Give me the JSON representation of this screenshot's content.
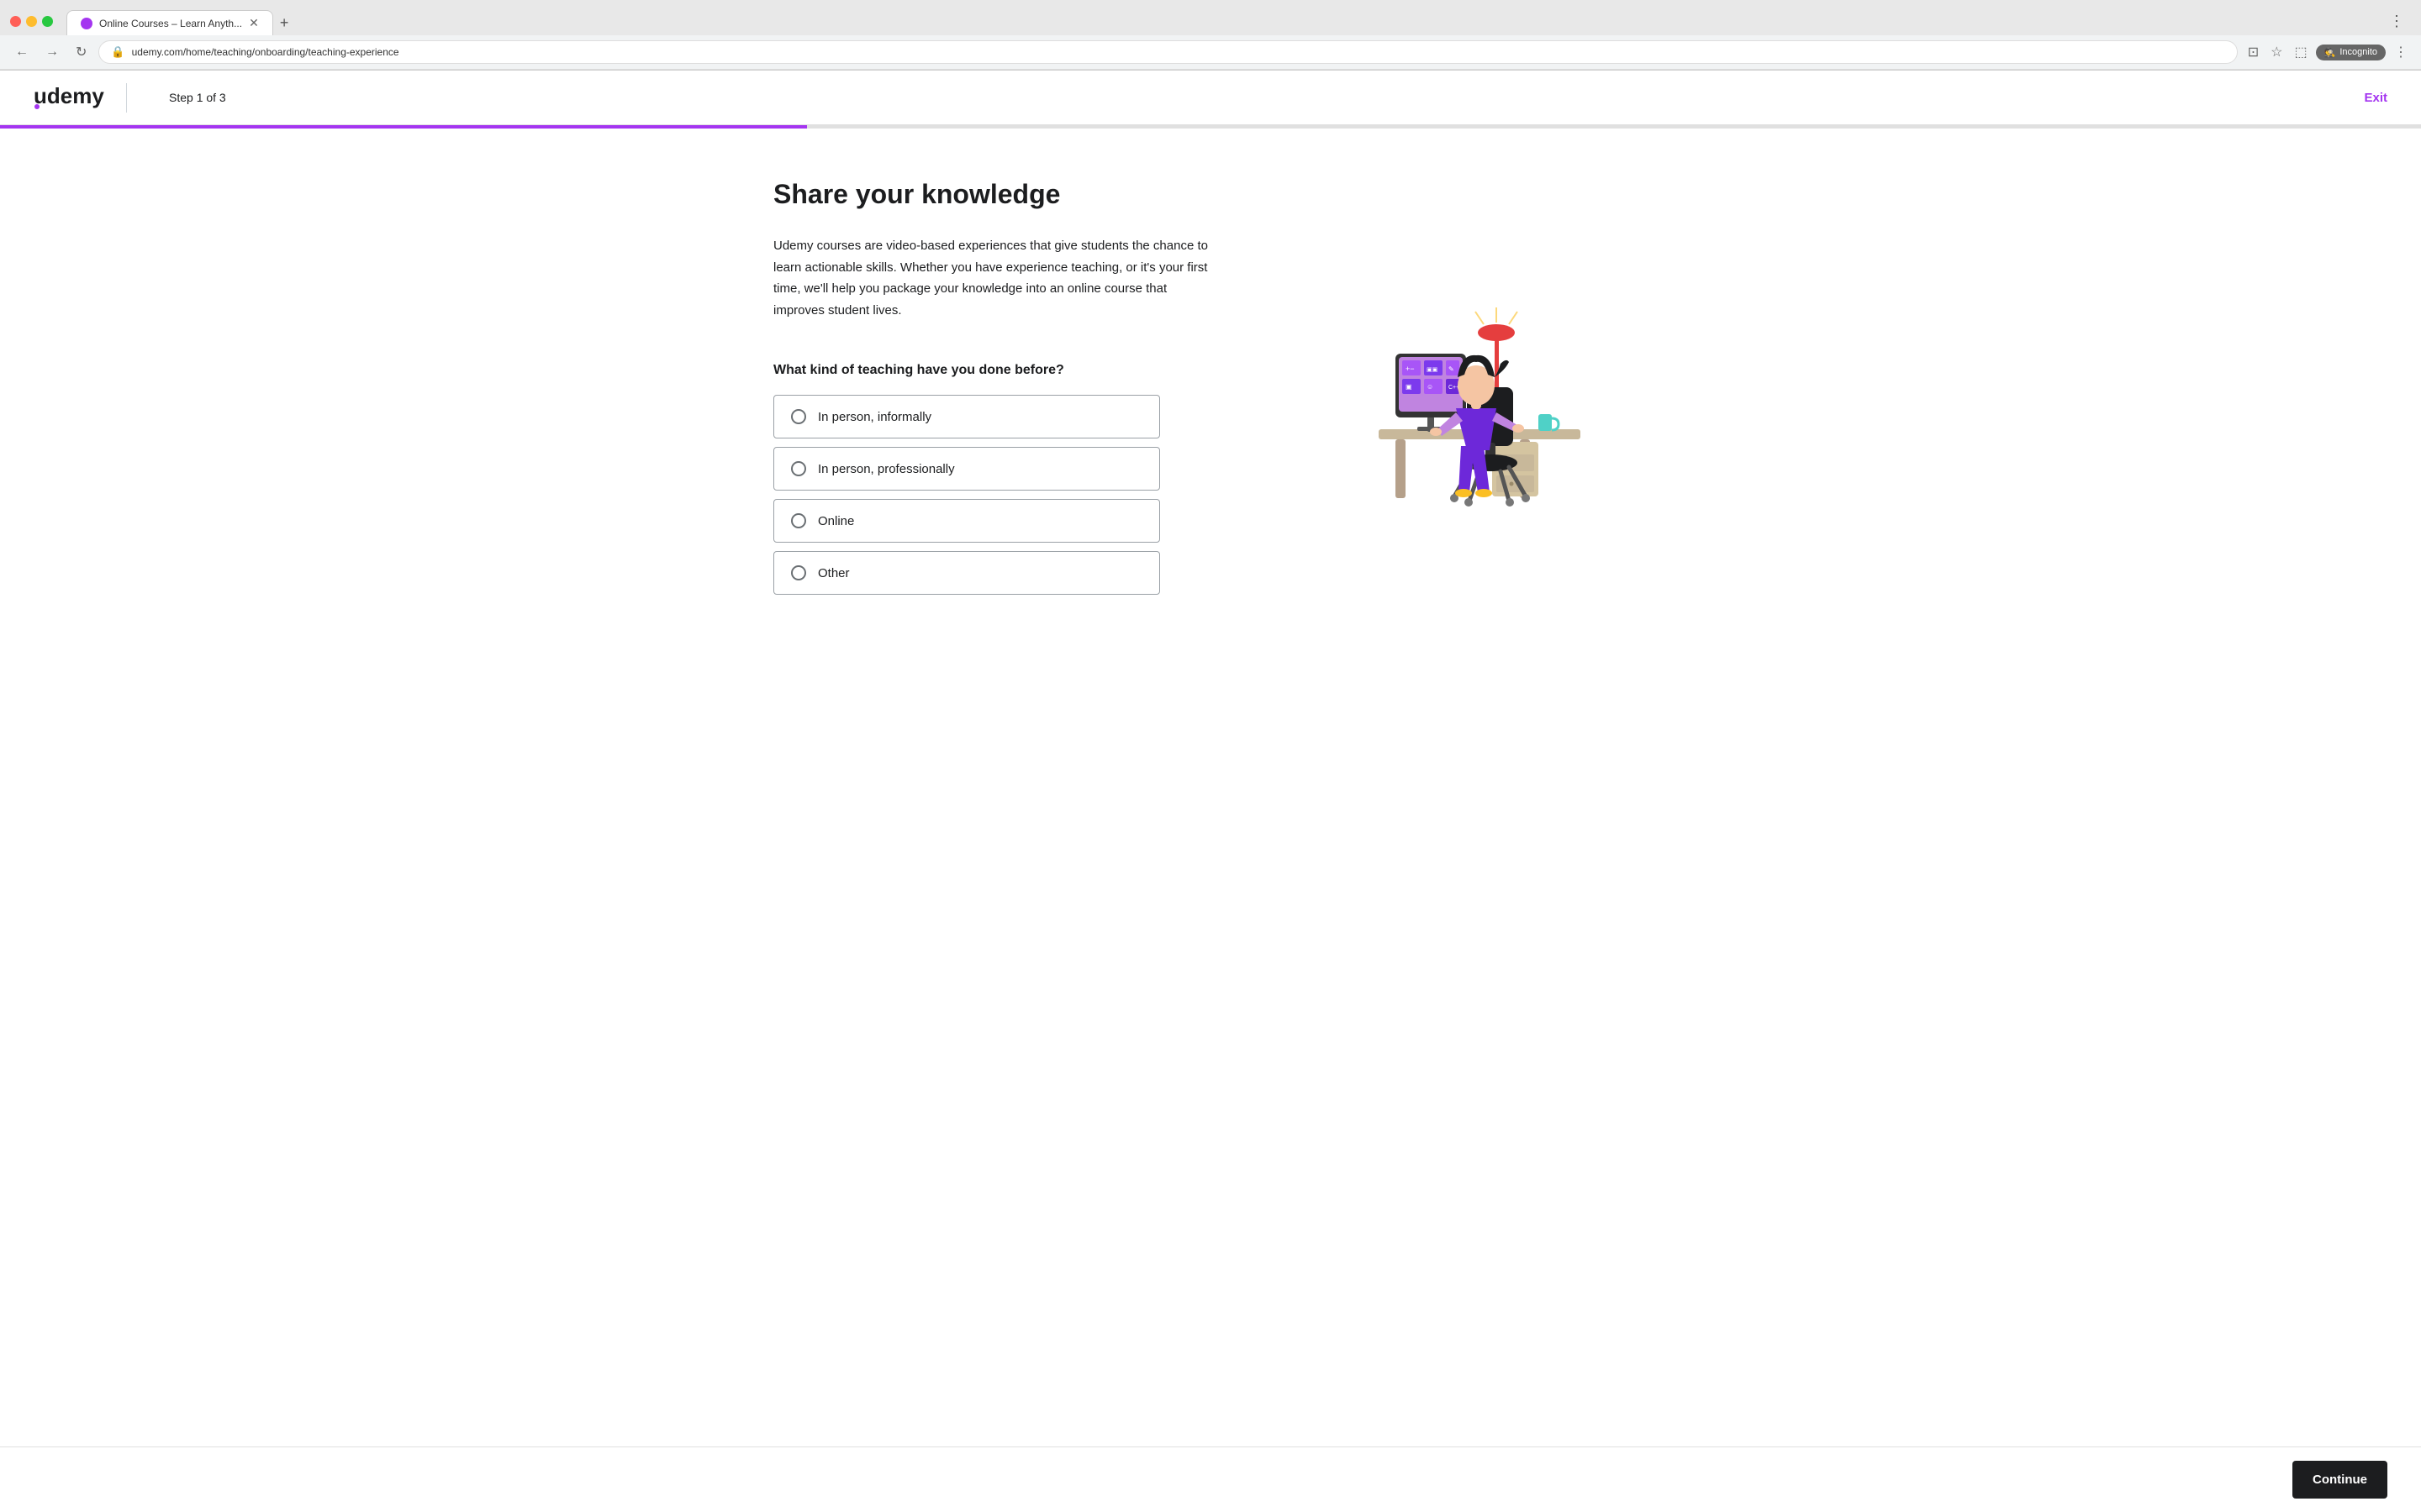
{
  "browser": {
    "tab_title": "Online Courses – Learn Anyth...",
    "url": "udemy.com/home/teaching/onboarding/teaching-experience",
    "incognito_label": "Incognito",
    "new_tab_label": "+"
  },
  "header": {
    "logo_text": "udemy",
    "step_label": "Step 1 of 3",
    "exit_label": "Exit"
  },
  "progress": {
    "percent": 33.33
  },
  "page": {
    "title": "Share your knowledge",
    "description": "Udemy courses are video-based experiences that give students the chance to learn actionable skills. Whether you have experience teaching, or it's your first time, we'll help you package your knowledge into an online course that improves student lives.",
    "question": "What kind of teaching have you done before?",
    "options": [
      {
        "id": "in-person-informally",
        "label": "In person, informally"
      },
      {
        "id": "in-person-professionally",
        "label": "In person, professionally"
      },
      {
        "id": "online",
        "label": "Online"
      },
      {
        "id": "other",
        "label": "Other"
      }
    ]
  },
  "footer": {
    "continue_label": "Continue"
  },
  "nav": {
    "back_icon": "←",
    "forward_icon": "→",
    "refresh_icon": "↻",
    "lock_icon": "🔒"
  }
}
